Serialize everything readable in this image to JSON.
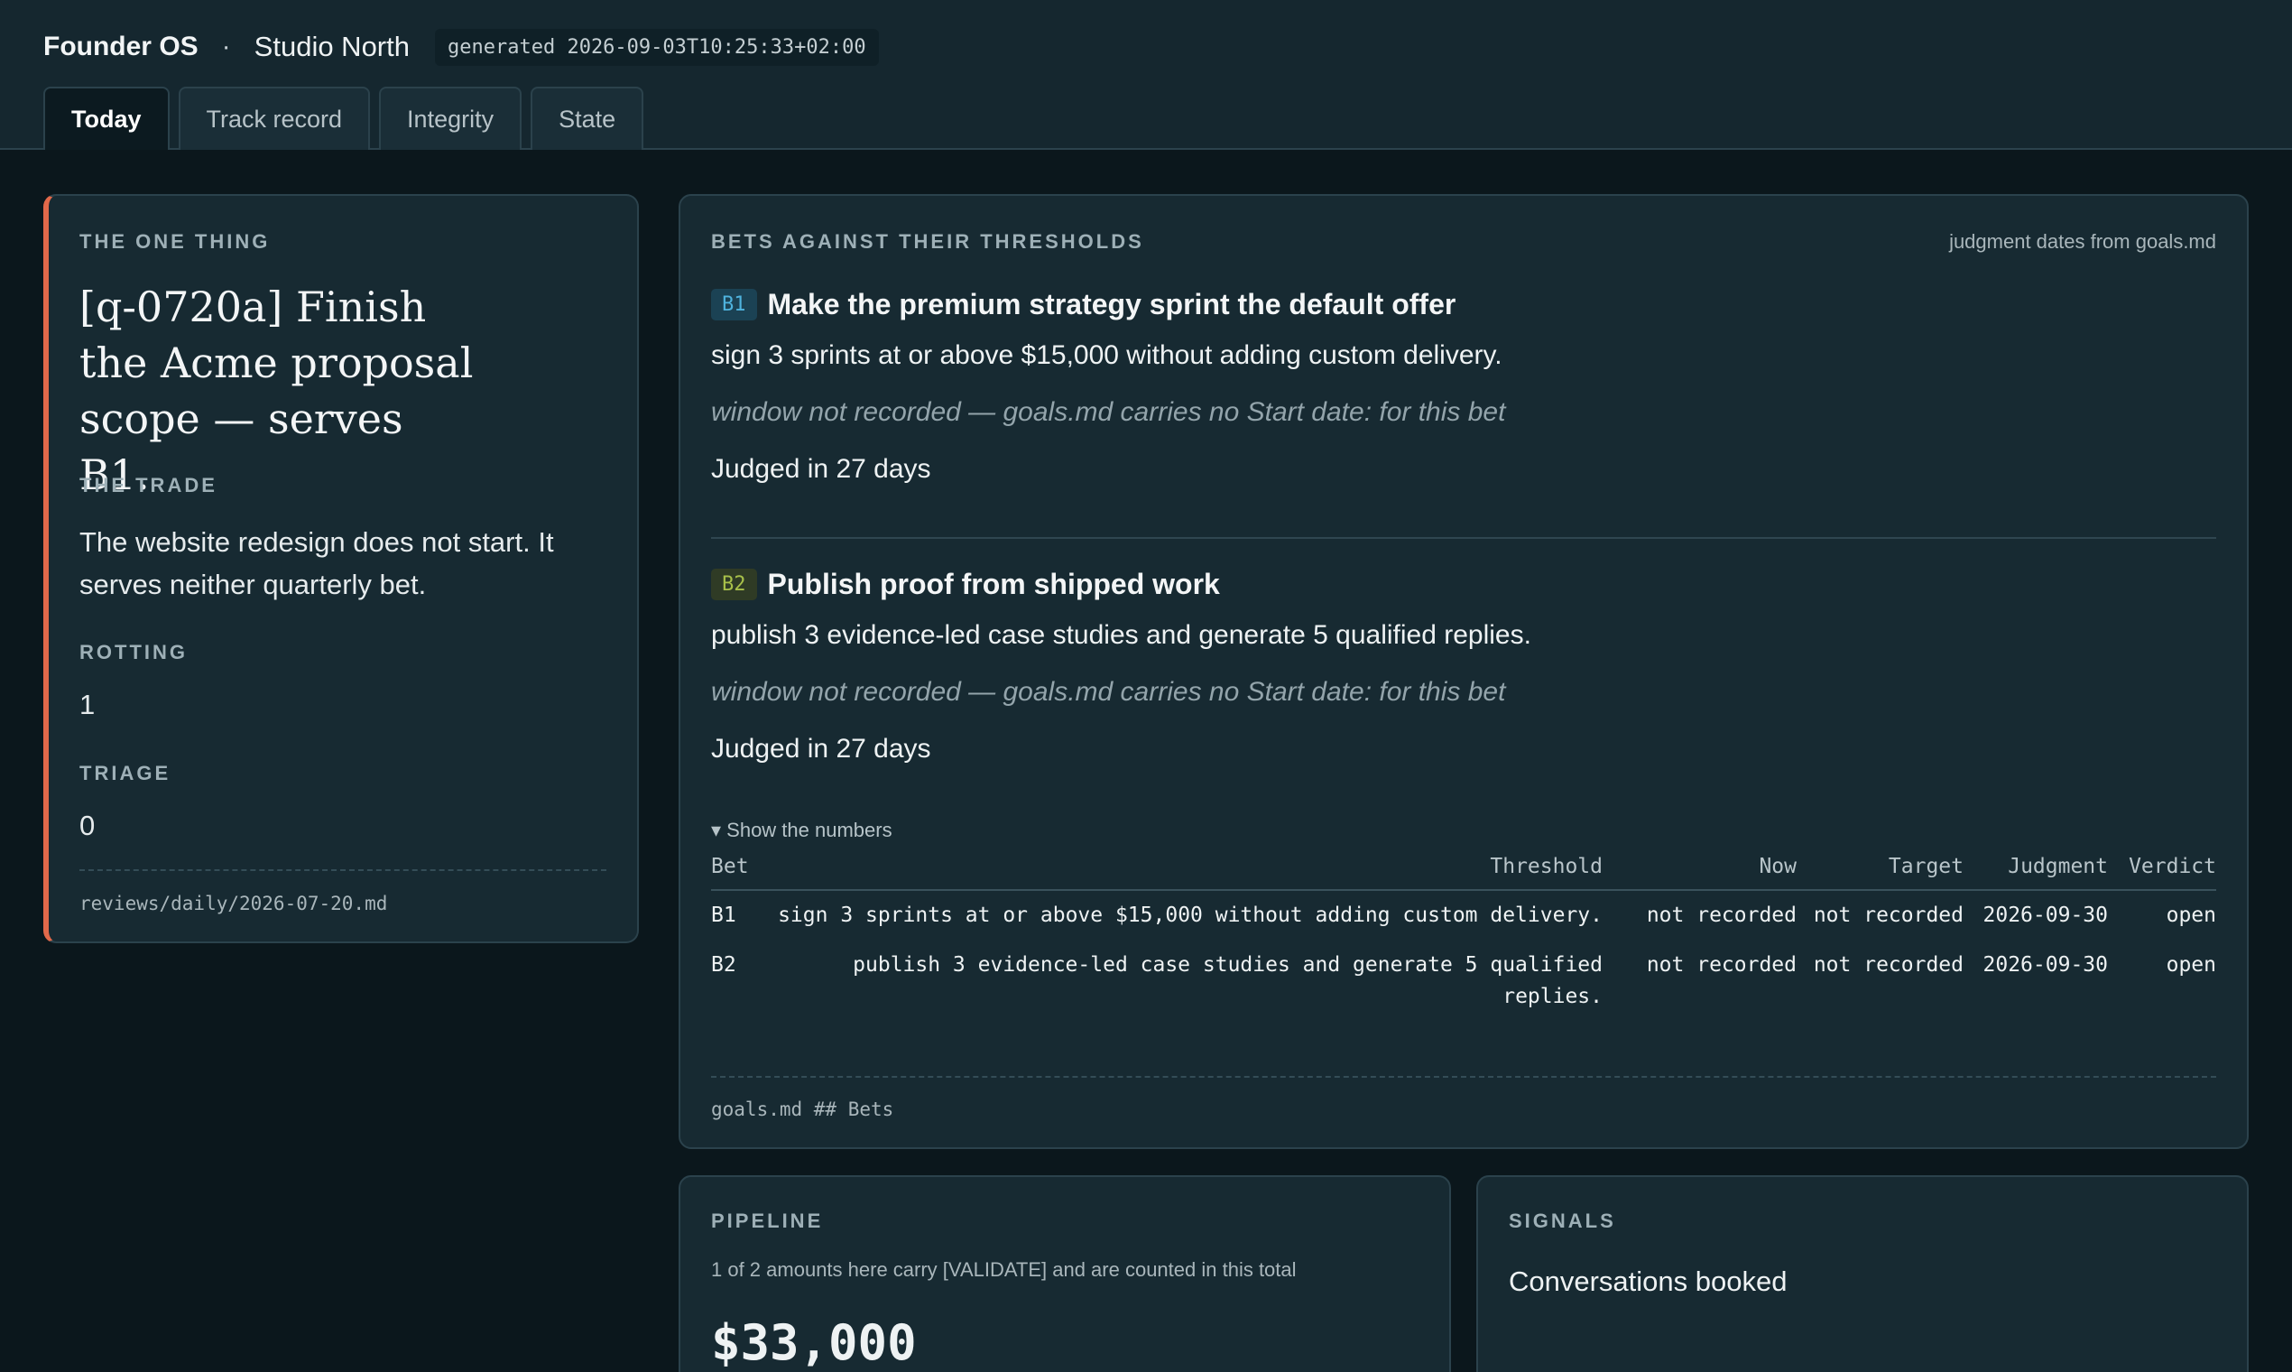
{
  "header": {
    "brand": "Founder OS",
    "separator": "·",
    "workspace": "Studio North",
    "generated": "generated 2026-09-03T10:25:33+02:00"
  },
  "tabs": [
    {
      "label": "Today",
      "active": true
    },
    {
      "label": "Track record",
      "active": false
    },
    {
      "label": "Integrity",
      "active": false
    },
    {
      "label": "State",
      "active": false
    }
  ],
  "one_thing": {
    "label": "THE ONE THING",
    "headline": "[q-0720a] Finish the Acme proposal scope — serves B1.",
    "trade_label": "THE TRADE",
    "trade": "The website redesign does not start. It serves neither quarterly bet.",
    "rotting_label": "ROTTING",
    "rotting": "1",
    "triage_label": "TRIAGE",
    "triage": "0",
    "source": "reviews/daily/2026-07-20.md",
    "accent_color": "#e2694a"
  },
  "bets": {
    "label": "BETS AGAINST THEIR THRESHOLDS",
    "note": "judgment dates from goals.md",
    "items": [
      {
        "tag": "B1",
        "title": "Make the premium strategy sprint the default offer",
        "threshold": "sign 3 sprints at or above $15,000 without adding custom delivery.",
        "window": "window not recorded — goals.md carries no Start date: for this bet",
        "judged": "Judged in 27 days",
        "tag_color": "#4fb3de"
      },
      {
        "tag": "B2",
        "title": "Publish proof from shipped work",
        "threshold": "publish 3 evidence-led case studies and generate 5 qualified replies.",
        "window": "window not recorded — goals.md carries no Start date: for this bet",
        "judged": "Judged in 27 days",
        "tag_color": "#a8c04a"
      }
    ],
    "toggle": "▾ Show the numbers",
    "table": {
      "headers": [
        "Bet",
        "Threshold",
        "Now",
        "Target",
        "Judgment",
        "Verdict"
      ],
      "rows": [
        [
          "B1",
          "sign 3 sprints at or above $15,000 without adding custom delivery.",
          "not recorded",
          "not recorded",
          "2026-09-30",
          "open"
        ],
        [
          "B2",
          "publish 3 evidence-led case studies and generate 5 qualified replies.",
          "not recorded",
          "not recorded",
          "2026-09-30",
          "open"
        ]
      ]
    },
    "source": "goals.md ## Bets"
  },
  "pipeline": {
    "label": "PIPELINE",
    "note": "1 of 2 amounts here carry [VALIDATE] and are counted in this total",
    "amount": "$33,000"
  },
  "signals": {
    "label": "SIGNALS",
    "first": "Conversations booked"
  }
}
